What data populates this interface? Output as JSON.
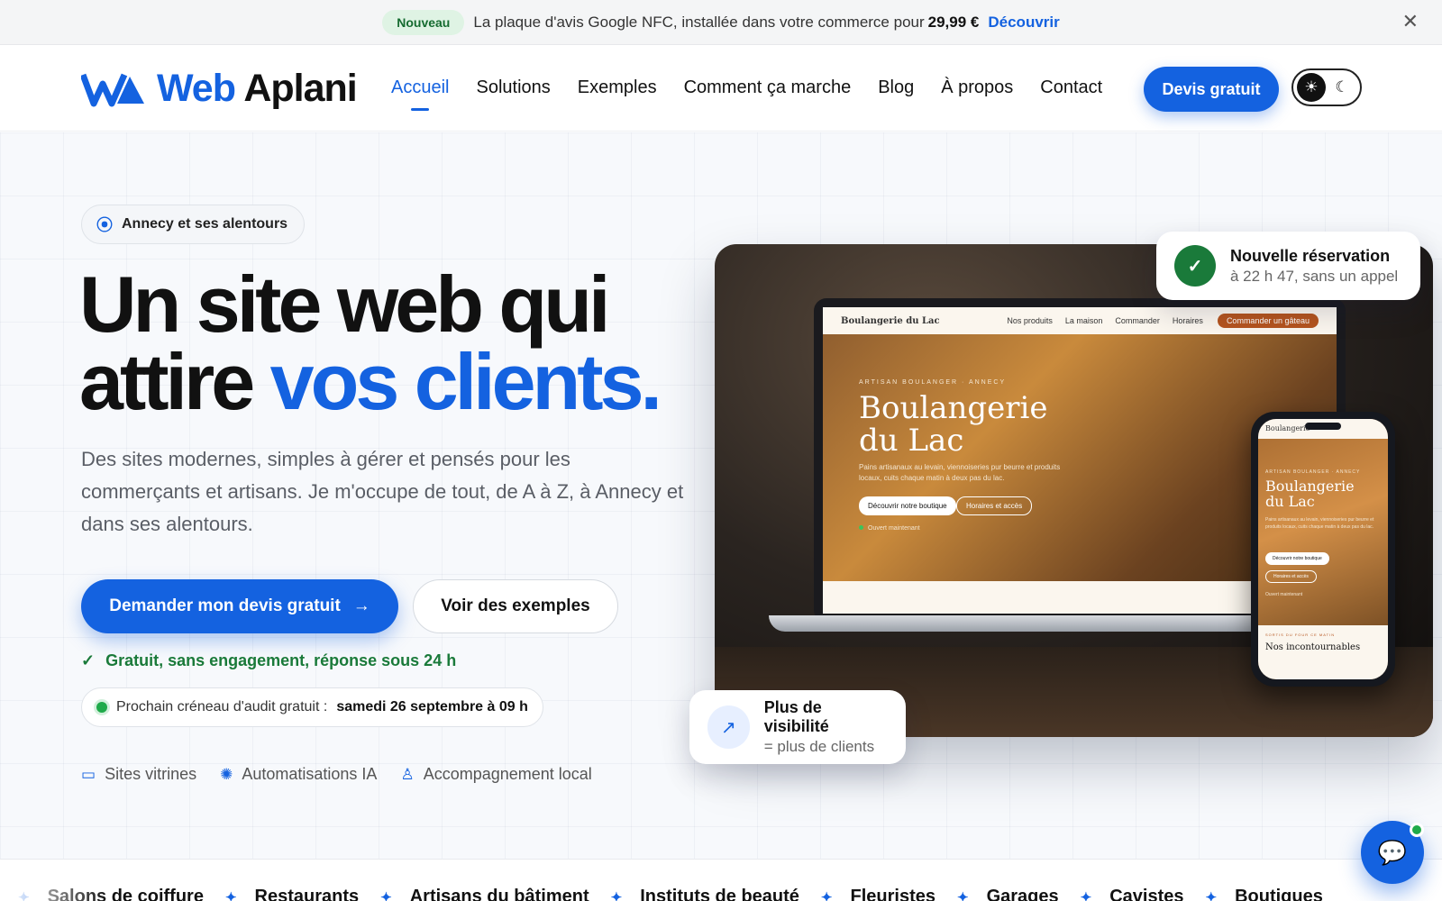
{
  "announcement": {
    "badge": "Nouveau",
    "text": "La plaque d'avis Google NFC, installée dans votre commerce pour",
    "price": "29,99 €",
    "link": "Découvrir",
    "close_icon": "close-icon"
  },
  "header": {
    "brand": "Web Aplani",
    "brand_part1": "Web",
    "brand_part2": "Aplani",
    "nav": [
      {
        "label": "Accueil",
        "active": true
      },
      {
        "label": "Solutions"
      },
      {
        "label": "Exemples"
      },
      {
        "label": "Comment ça marche"
      },
      {
        "label": "Blog"
      },
      {
        "label": "À propos"
      },
      {
        "label": "Contact"
      }
    ],
    "cta": "Devis gratuit",
    "theme_icons": [
      "sun-icon",
      "moon-icon"
    ]
  },
  "hero": {
    "location": "Annecy et ses alentours",
    "headline_line1": "Un site web qui",
    "headline_line2_a": "attire",
    "headline_line2_b": "vos clients.",
    "subtext": "Des sites modernes, simples à gérer et pensés pour les commerçants et artisans. Je m'occupe de tout, de A à Z, à Annecy et dans ses alentours.",
    "primary_cta": "Demander mon devis gratuit",
    "secondary_cta": "Voir des exemples",
    "guarantee": "Gratuit, sans engagement, réponse sous 24 h",
    "slot_label": "Prochain créneau d'audit gratuit :",
    "slot_value": "samedi 26 septembre à 09 h",
    "features": [
      "Sites vitrines",
      "Automatisations IA",
      "Accompagnement local"
    ]
  },
  "mockup": {
    "site_name": "Boulangerie du Lac",
    "site_nav": [
      "Nos produits",
      "La maison",
      "Commander",
      "Horaires"
    ],
    "site_cta": "Commander un gâteau",
    "kicker": "ARTISAN BOULANGER · ANNECY",
    "title_line1": "Boulangerie",
    "title_line2": "du Lac",
    "description": "Pains artisanaux au levain, viennoiseries pur beurre et produits locaux, cuits chaque matin à deux pas du lac.",
    "button1": "Découvrir notre boutique",
    "button2": "Horaires et accès",
    "status": "Ouvert maintenant",
    "phone_brand": "Boulangerie",
    "phone_section_kicker": "SORTIS DU FOUR CE MATIN",
    "phone_section_title": "Nos incontournables"
  },
  "cards": {
    "reservation_title": "Nouvelle réservation",
    "reservation_sub": "à 22 h 47, sans un appel",
    "visibility_title": "Plus de visibilité",
    "visibility_sub": "= plus de clients"
  },
  "ticker": [
    "Salons de coiffure",
    "Restaurants",
    "Artisans du bâtiment",
    "Instituts de beauté",
    "Fleuristes",
    "Garages",
    "Cavistes",
    "Boutiques"
  ],
  "colors": {
    "accent": "#1462e0",
    "success": "#1a7a3a"
  }
}
